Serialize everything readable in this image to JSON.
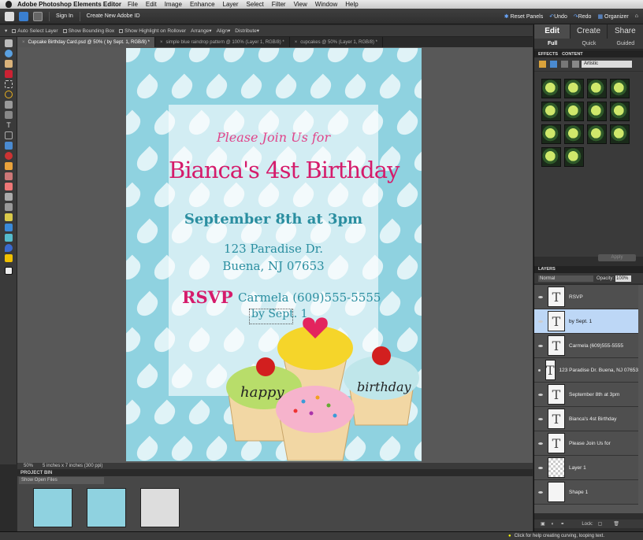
{
  "menubar": {
    "app_name": "Adobe Photoshop Elements Editor",
    "items": [
      "File",
      "Edit",
      "Image",
      "Enhance",
      "Layer",
      "Select",
      "Filter",
      "View",
      "Window",
      "Help"
    ]
  },
  "topbar": {
    "sign_in": "Sign In",
    "create_id": "Create New Adobe ID",
    "reset_panels": "Reset Panels",
    "undo": "Undo",
    "redo": "Redo",
    "organizer": "Organizer"
  },
  "options_bar": {
    "auto_select": "Auto Select Layer",
    "bounding_box": "Show Bounding Box",
    "highlight": "Show Highlight on Rollover",
    "arrange": "Arrange",
    "align": "Align",
    "distribute": "Distribute"
  },
  "doc_tabs": [
    {
      "label": "Cupcake Birthday Card.psd @ 50% ( by Sept. 1, RGB/8) *",
      "active": true
    },
    {
      "label": "simple blue raindrop pattern @ 100% (Layer 1, RGB/8) *",
      "active": false
    },
    {
      "label": "cupcakes @ 50% (Layer 1, RGB/8) *",
      "active": false
    }
  ],
  "card": {
    "join": "Please Join Us for",
    "name": "Bianca's 4st Birthday",
    "date": "September 8th at 3pm",
    "address1": "123 Paradise Dr.",
    "address2": "Buena, NJ 07653",
    "rsvp": "RSVP",
    "rsvp_contact": "Carmela (609)555-5555",
    "by": "by Sept. 1",
    "happy": "happy",
    "birthday": "birthday"
  },
  "colors": {
    "pink": "#d51b6b",
    "teal": "#2a8ea0",
    "background": "#8fd2e0"
  },
  "status": {
    "zoom": "50%",
    "size": "5 inches x 7 inches (300 ppi)"
  },
  "project_bin": {
    "title": "PROJECT BIN",
    "show": "Show Open Files"
  },
  "panel": {
    "tabs": [
      "Edit",
      "Create",
      "Share"
    ],
    "subtabs": [
      "Full",
      "Quick",
      "Guided"
    ],
    "effects_tab": "EFFECTS",
    "content_tab": "CONTENT",
    "filter_category": "Artistic",
    "apply": "Apply"
  },
  "layers_panel": {
    "title": "LAYERS",
    "blend": "Normal",
    "opacity_label": "Opacity:",
    "opacity_value": "100%",
    "lock_label": "Lock:",
    "items": [
      {
        "name": "RSVP",
        "type": "text",
        "selected": false
      },
      {
        "name": "by Sept. 1",
        "type": "text",
        "selected": true
      },
      {
        "name": "Carmela (609)555-5555",
        "type": "text",
        "selected": false
      },
      {
        "name": "123 Paradise Dr. Buena, NJ 07653",
        "type": "text",
        "selected": false
      },
      {
        "name": "September 8th at 3pm",
        "type": "text",
        "selected": false
      },
      {
        "name": "Bianca's 4st Birthday",
        "type": "text",
        "selected": false
      },
      {
        "name": "Please Join Us for",
        "type": "text",
        "selected": false
      },
      {
        "name": "Layer 1",
        "type": "image",
        "selected": false
      },
      {
        "name": "Shape 1",
        "type": "shape",
        "selected": false
      }
    ]
  },
  "footer": {
    "hint": "Click for help creating curving, looping text."
  }
}
